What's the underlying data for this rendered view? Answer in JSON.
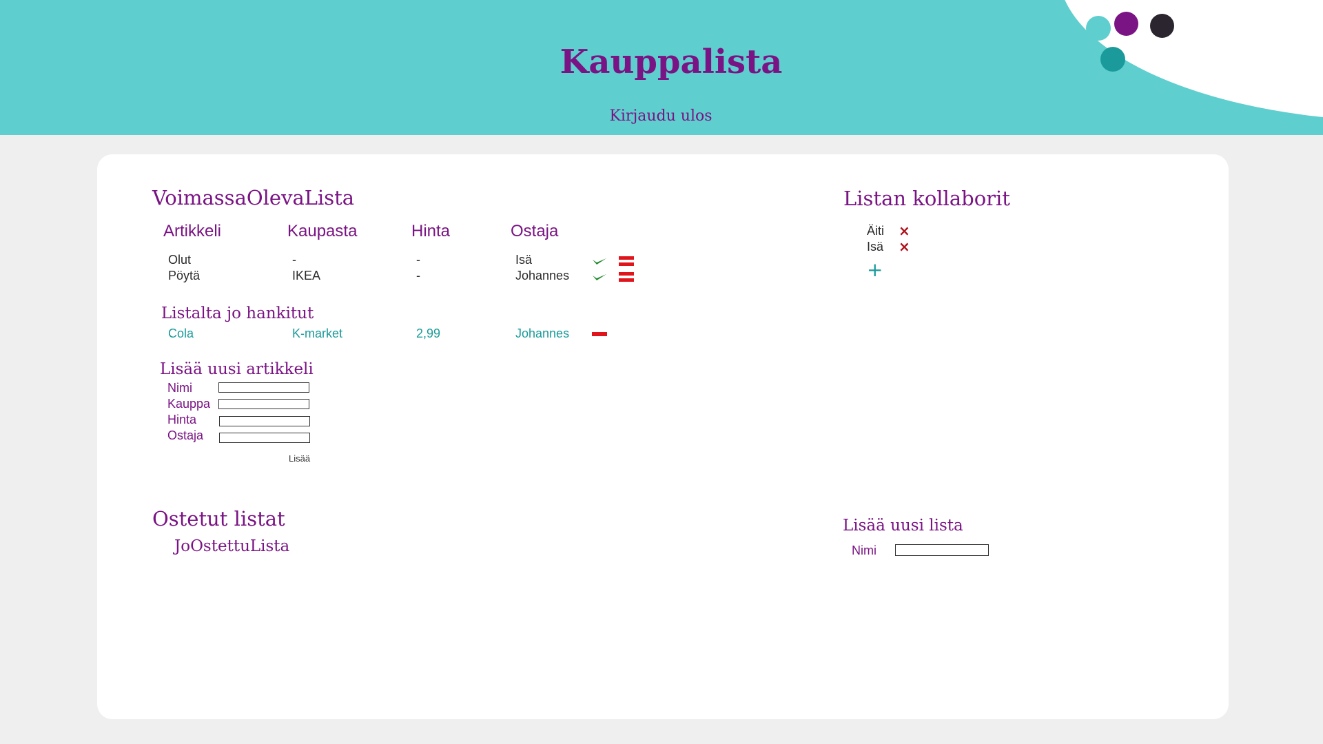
{
  "header": {
    "title": "Kauppalista",
    "logout_label": "Kirjaudu ulos"
  },
  "current_list": {
    "title": "VoimassaOlevaLista",
    "columns": [
      "Artikkeli",
      "Kaupasta",
      "Hinta",
      "Ostaja"
    ],
    "rows": [
      {
        "item": "Olut",
        "store": "-",
        "price": "-",
        "buyer": "Isä"
      },
      {
        "item": "Pöytä",
        "store": "IKEA",
        "price": "-",
        "buyer": "Johannes"
      }
    ]
  },
  "acquired": {
    "title": "Listalta jo hankitut",
    "rows": [
      {
        "item": "Cola",
        "store": "K-market",
        "price": "2,99",
        "buyer": "Johannes"
      }
    ]
  },
  "add_item": {
    "title": "Lisää uusi artikkeli",
    "fields": [
      "Nimi",
      "Kauppa",
      "Hinta",
      "Ostaja"
    ],
    "submit_label": "Lisää"
  },
  "bought_lists": {
    "title": "Ostetut listat",
    "items": [
      "JoOstettuLista"
    ]
  },
  "collaborators": {
    "title": "Listan kollaborit",
    "people": [
      "Äiti",
      "Isä"
    ],
    "add_symbol": "+",
    "remove_symbol": "×"
  },
  "add_list": {
    "title": "Lisää uusi lista",
    "name_label": "Nimi"
  },
  "colors": {
    "accent_purple": "#7a1384",
    "header_teal": "#5ecece",
    "bought_teal": "#1a9a9a",
    "check_green": "#1f8a2a",
    "remove_red": "#e0141b"
  },
  "icons": [
    "check-icon",
    "equal-icon",
    "minus-icon",
    "close-icon",
    "plus-icon"
  ]
}
